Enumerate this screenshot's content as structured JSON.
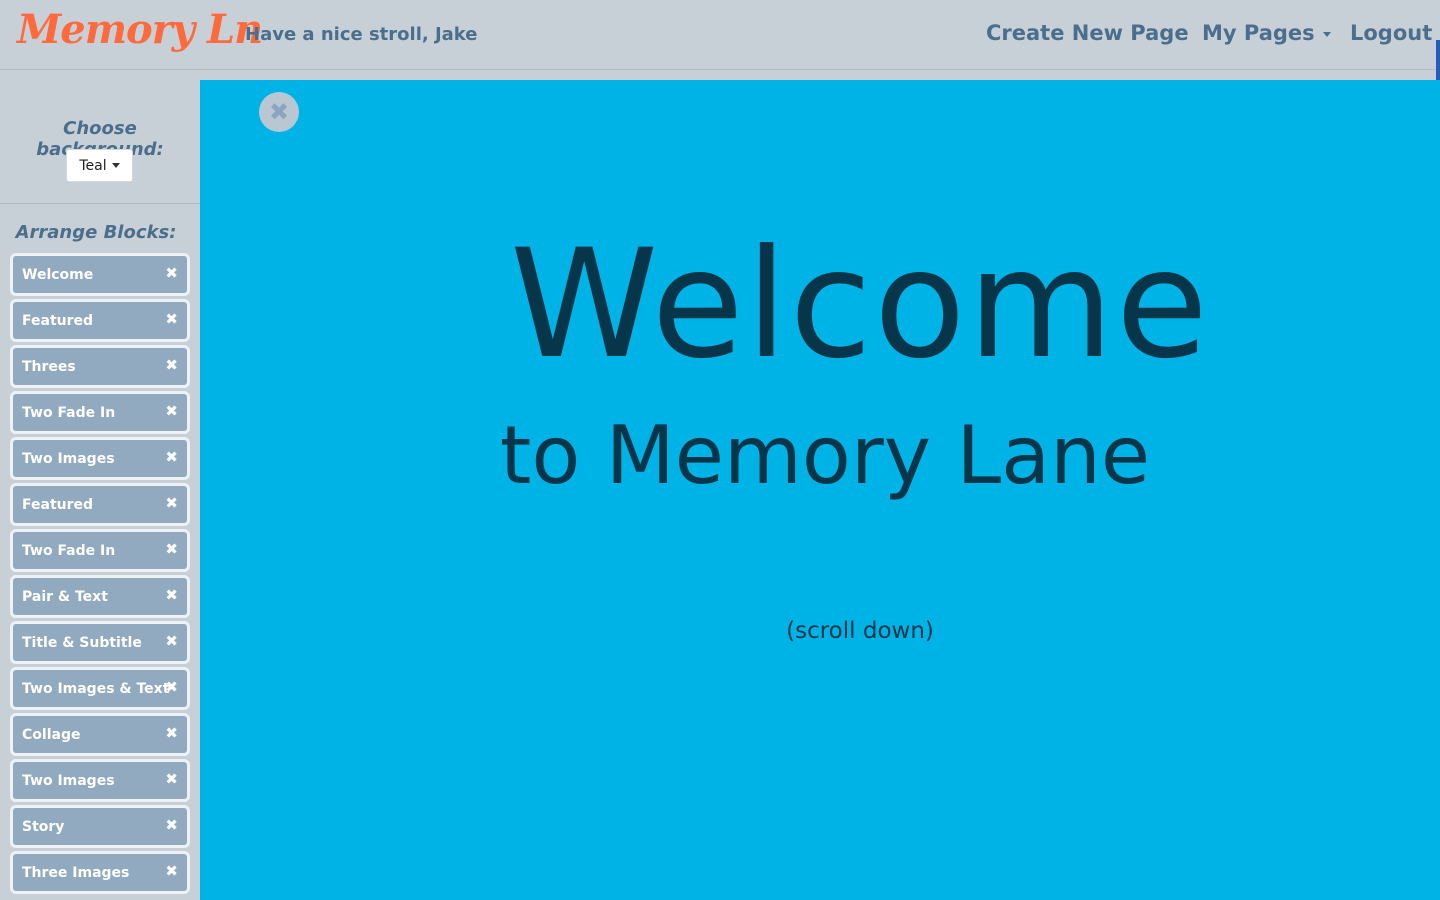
{
  "navbar": {
    "brand": "Memory Ln",
    "greeting": "Have a nice stroll, Jake",
    "create_label": "Create New Page",
    "my_pages_label": "My Pages",
    "logout_label": "Logout"
  },
  "sidebar": {
    "background_label": "Choose background:",
    "background_value": "Teal",
    "arrange_label": "Arrange Blocks:",
    "close_glyph": "✖",
    "blocks": [
      "Welcome",
      "Featured",
      "Threes",
      "Two Fade In",
      "Two Images",
      "Featured",
      "Two Fade In",
      "Pair & Text",
      "Title & Subtitle",
      "Two Images & Text",
      "Collage",
      "Two Images",
      "Story",
      "Three Images"
    ]
  },
  "preview": {
    "close_glyph": "✖",
    "title": "Welcome",
    "subtitle": "to Memory Lane",
    "scroll_hint": "(scroll down)",
    "background_color": "#00b3e6",
    "text_color": "#07364a"
  },
  "colors": {
    "brand": "#ff6a3d",
    "nav_text": "#4b6e8c",
    "chrome_bg": "#c8d0d7",
    "block_bg": "#91aac0"
  }
}
